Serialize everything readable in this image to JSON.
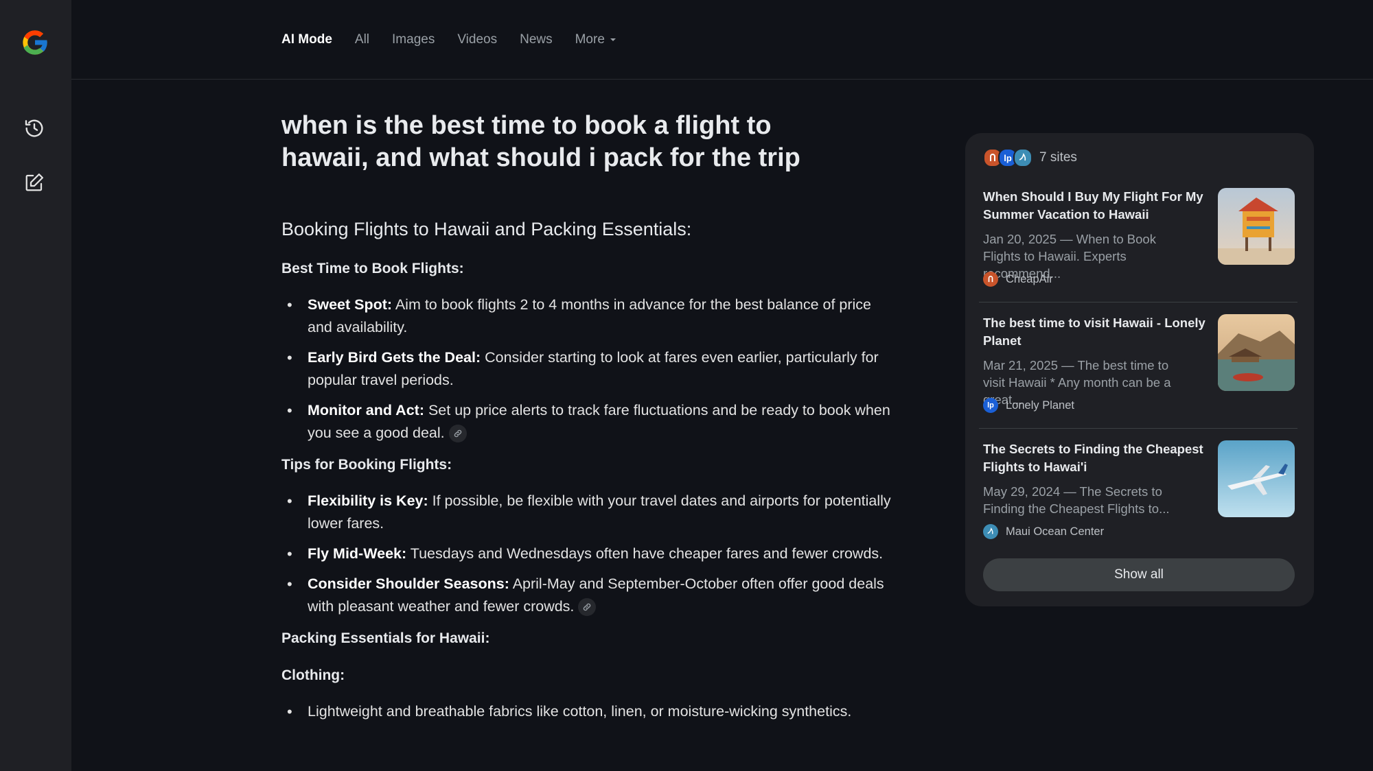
{
  "nav": {
    "tabs": [
      {
        "label": "AI Mode"
      },
      {
        "label": "All"
      },
      {
        "label": "Images"
      },
      {
        "label": "Videos"
      },
      {
        "label": "News"
      },
      {
        "label": "More"
      }
    ]
  },
  "rail": {
    "icons": [
      "google-logo",
      "history-icon",
      "new-chat-icon"
    ]
  },
  "query": "when is the best time to book a flight to hawaii, and what should i pack for the trip",
  "answer": {
    "heading": "Booking Flights to Hawaii and Packing Essentials:",
    "sections": [
      {
        "title": "Best Time to Book Flights:",
        "items": [
          {
            "bold": "Sweet Spot:",
            "text": " Aim to book flights 2 to 4 months in advance for the best balance of price and availability."
          },
          {
            "bold": "Early Bird Gets the Deal:",
            "text": " Consider starting to look at fares even earlier, particularly for popular travel periods."
          },
          {
            "bold": "Monitor and Act:",
            "text": " Set up price alerts to track fare fluctuations and be ready to book when you see a good deal."
          }
        ]
      },
      {
        "title": "Tips for Booking Flights:",
        "items": [
          {
            "bold": "Flexibility is Key:",
            "text": " If possible, be flexible with your travel dates and airports for potentially lower fares."
          },
          {
            "bold": "Fly Mid-Week:",
            "text": " Tuesdays and Wednesdays often have cheaper fares and fewer crowds."
          },
          {
            "bold": "Consider Shoulder Seasons:",
            "text": " April-May and September-October often offer good deals with pleasant weather and fewer crowds."
          }
        ]
      },
      {
        "title": "Packing Essentials for Hawaii:"
      },
      {
        "title": "Clothing:",
        "items": [
          {
            "text": "Lightweight and breathable fabrics like cotton, linen, or moisture-wicking synthetics."
          }
        ]
      }
    ]
  },
  "sources": {
    "count_label": "7 sites",
    "cards": [
      {
        "title": "When Should I Buy My Flight For My Summer Vacation to Hawaii",
        "snippet": "Jan 20, 2025 — When to Book Flights to Hawaii. Experts recommend...",
        "source": "CheapAir",
        "favicon_color": "#c9542b"
      },
      {
        "title": "The best time to visit Hawaii - Lonely Planet",
        "snippet": "Mar 21, 2025 — The best time to visit Hawaii * Any month can be a great...",
        "source": "Lonely Planet",
        "favicon_color": "#1a5fd6"
      },
      {
        "title": "The Secrets to Finding the Cheapest Flights to Hawai'i",
        "snippet": "May 29, 2024 — The Secrets to Finding the Cheapest Flights to...",
        "source": "Maui Ocean Center",
        "favicon_color": "#3d8db5"
      }
    ],
    "show_all_label": "Show all"
  }
}
